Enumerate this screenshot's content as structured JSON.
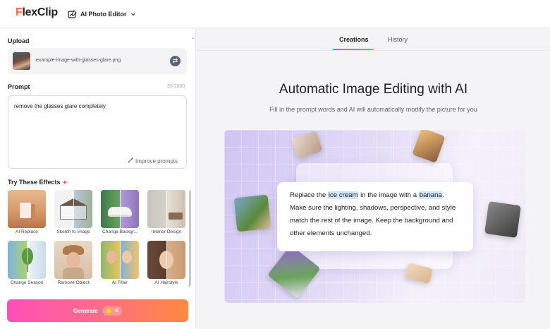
{
  "header": {
    "logo": "FlexClip",
    "tool_name": "AI Photo Editor",
    "tool_icon": "photo-edit-icon",
    "dropdown_icon": "chevron-down-icon"
  },
  "left": {
    "upload_label": "Upload",
    "file_name": "example-image-with-glasses-glare.png",
    "prompt_label": "Prompt",
    "prompt_counter": "35/1000",
    "prompt_text": "remove the glasses glare completely",
    "improve_label": "Improve prompts",
    "effects_label": "Try These Effects",
    "effects": [
      {
        "label": "AI Replace"
      },
      {
        "label": "Sketch to Image"
      },
      {
        "label": "Change Backgr..."
      },
      {
        "label": "Interior Design"
      },
      {
        "label": "Change Season"
      },
      {
        "label": "Remove Object"
      },
      {
        "label": "AI Filter"
      },
      {
        "label": "AI Hairstyle"
      }
    ],
    "generate_label": "Generate",
    "generate_cost": "-5"
  },
  "right": {
    "tabs": [
      {
        "label": "Creations",
        "active": true
      },
      {
        "label": "History",
        "active": false
      }
    ],
    "title": "Automatic Image Editing with AI",
    "subtitle": "Fill in the prompt words and AI will automatically modify the picture for you",
    "example": {
      "p1": "Replace the ",
      "h1": "ice cream",
      "p2": " in the image with a ",
      "h2": "banana",
      "p3": ". Make sure the lighting, shadows, perspective, and style match the rest of the image. Keep the background and other elements unchanged."
    }
  },
  "colors": {
    "accent_pink": "#ff4fb8",
    "accent_orange": "#ff8a3d",
    "highlight": "#cfe6fb"
  }
}
